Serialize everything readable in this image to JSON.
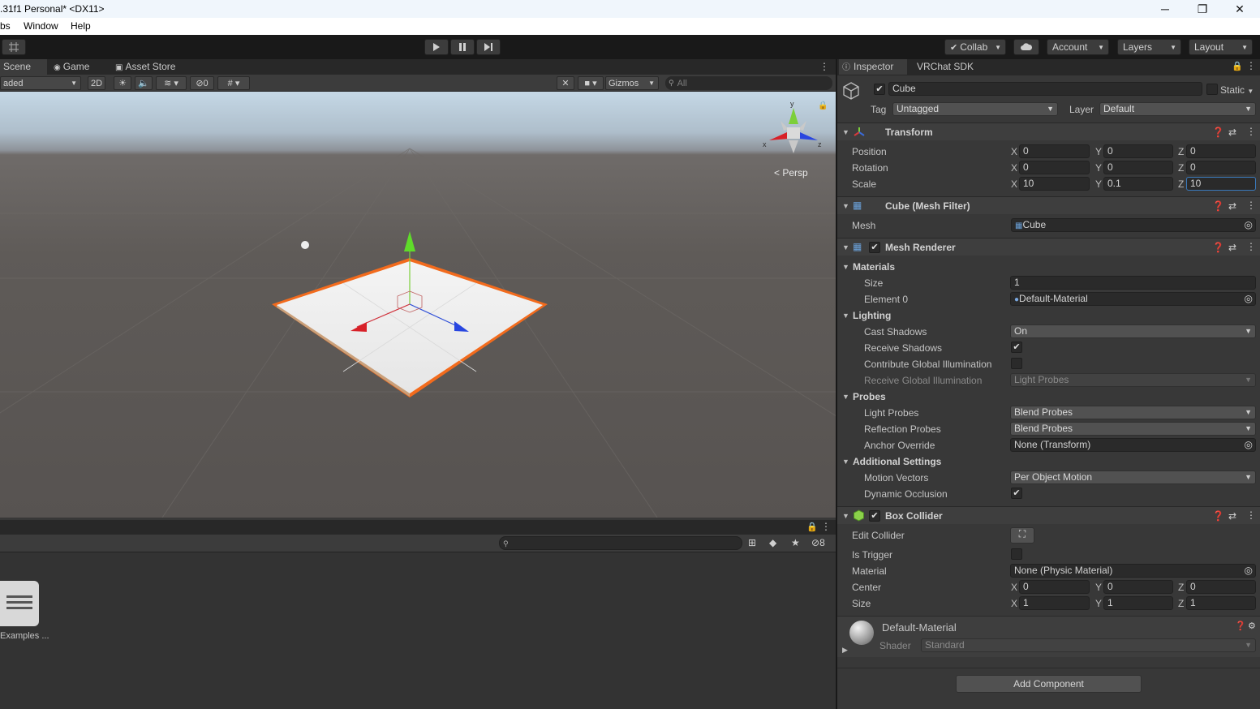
{
  "window": {
    "title": ".31f1 Personal* <DX11>",
    "minimize": "─",
    "maximize": "❐",
    "close": "✕"
  },
  "menu": {
    "items": [
      "bs",
      "Window",
      "Help"
    ]
  },
  "toolbar": {
    "collab": "Collab",
    "account": "Account",
    "layers": "Layers",
    "layout": "Layout"
  },
  "scene": {
    "tabs": [
      "Scene",
      "Game",
      "Asset Store"
    ],
    "shading": "aded",
    "mode_2d": "2D",
    "hidden_count": "0",
    "gizmos": "Gizmos",
    "search_placeholder": "All",
    "persp": "Persp",
    "gizmo_y": "y",
    "gizmo_x": "x",
    "gizmo_z": "z"
  },
  "project": {
    "hidden_count": "8",
    "items": [
      {
        "label": "Examples ..."
      }
    ]
  },
  "inspector": {
    "tabs": [
      "Inspector",
      "VRChat SDK"
    ],
    "object_name": "Cube",
    "static_label": "Static",
    "tag_label": "Tag",
    "tag_value": "Untagged",
    "layer_label": "Layer",
    "layer_value": "Default",
    "transform": {
      "title": "Transform",
      "position_label": "Position",
      "rotation_label": "Rotation",
      "scale_label": "Scale",
      "position": [
        "0",
        "0",
        "0"
      ],
      "rotation": [
        "0",
        "0",
        "0"
      ],
      "scale": [
        "10",
        "0.1",
        "10"
      ]
    },
    "mesh_filter": {
      "title": "Cube (Mesh Filter)",
      "mesh_label": "Mesh",
      "mesh_value": "Cube"
    },
    "mesh_renderer": {
      "title": "Mesh Renderer",
      "materials": "Materials",
      "size_label": "Size",
      "size_value": "1",
      "element0_label": "Element 0",
      "element0_value": "Default-Material",
      "lighting": "Lighting",
      "cast_shadows_label": "Cast Shadows",
      "cast_shadows_value": "On",
      "receive_shadows_label": "Receive Shadows",
      "contribute_gi_label": "Contribute Global Illumination",
      "receive_gi_label": "Receive Global Illumination",
      "receive_gi_value": "Light Probes",
      "probes": "Probes",
      "light_probes_label": "Light Probes",
      "light_probes_value": "Blend Probes",
      "reflection_probes_label": "Reflection Probes",
      "reflection_probes_value": "Blend Probes",
      "anchor_override_label": "Anchor Override",
      "anchor_override_value": "None (Transform)",
      "additional": "Additional Settings",
      "motion_vectors_label": "Motion Vectors",
      "motion_vectors_value": "Per Object Motion",
      "dynamic_occlusion_label": "Dynamic Occlusion"
    },
    "box_collider": {
      "title": "Box Collider",
      "edit_collider_label": "Edit Collider",
      "is_trigger_label": "Is Trigger",
      "material_label": "Material",
      "material_value": "None (Physic Material)",
      "center_label": "Center",
      "size_label": "Size",
      "center": [
        "0",
        "0",
        "0"
      ],
      "size": [
        "1",
        "1",
        "1"
      ]
    },
    "material": {
      "name": "Default-Material",
      "shader_label": "Shader",
      "shader_value": "Standard"
    },
    "add_component": "Add Component"
  },
  "axis_labels": [
    "X",
    "Y",
    "Z"
  ],
  "colors": {
    "accent_selection": "#f26b1d",
    "toolbar_bg": "#191919",
    "panel_bg": "#383838"
  }
}
